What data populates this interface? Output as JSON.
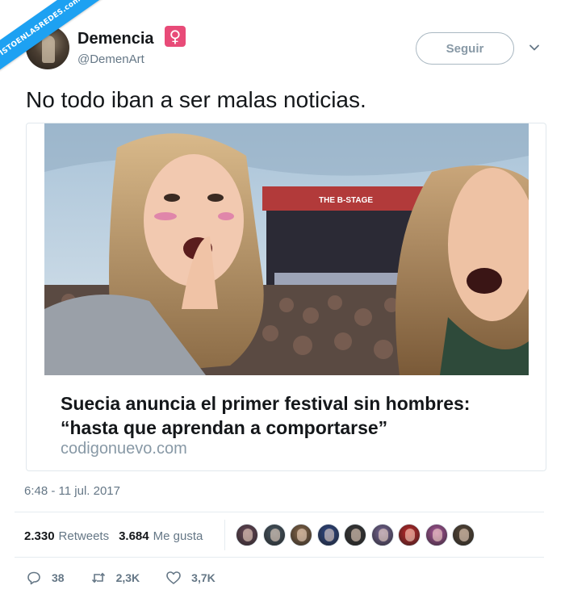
{
  "watermark": {
    "text": "VISTOENLASREDES.com"
  },
  "user": {
    "display_name": "Demencia",
    "badge_icon": "venus-icon",
    "badge_glyph": "♀",
    "handle": "@DemenArt"
  },
  "follow_button": {
    "label": "Seguir"
  },
  "tweet": {
    "text": "No todo iban a ser malas noticias."
  },
  "card": {
    "title": "Suecia anuncia el primer festival sin hombres: “hasta que aprendan a comportarse”",
    "domain": "codigonuevo.com",
    "stage_banner": "THE B-STAGE"
  },
  "timestamp": "6:48 - 11 jul. 2017",
  "stats": {
    "retweets_count": "2.330",
    "retweets_label": "Retweets",
    "likes_count": "3.684",
    "likes_label": "Me gusta"
  },
  "likers": [
    {
      "name": "liker-avatar-1",
      "color": "#6b4a5a"
    },
    {
      "name": "liker-avatar-2",
      "color": "#4a5a66"
    },
    {
      "name": "liker-avatar-3",
      "color": "#8a6a4a"
    },
    {
      "name": "liker-avatar-4",
      "color": "#2f4a8a"
    },
    {
      "name": "liker-avatar-5",
      "color": "#3a3a3a"
    },
    {
      "name": "liker-avatar-6",
      "color": "#7a6a9a"
    },
    {
      "name": "liker-avatar-7",
      "color": "#c8282a"
    },
    {
      "name": "liker-avatar-8",
      "color": "#b05aa0"
    },
    {
      "name": "liker-avatar-9",
      "color": "#5a4a3a"
    }
  ],
  "actions": {
    "replies": "38",
    "retweets": "2,3K",
    "likes": "3,7K"
  },
  "colors": {
    "accent": "#1da1f2",
    "text_primary": "#14171a",
    "text_secondary": "#657786",
    "badge": "#e84b78"
  }
}
